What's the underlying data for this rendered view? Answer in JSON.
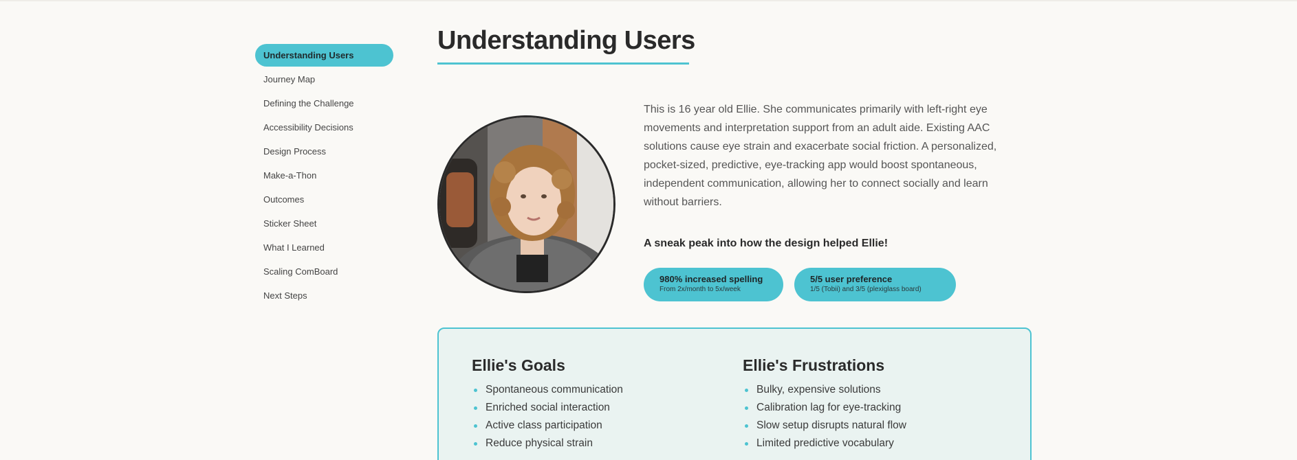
{
  "sidebar": {
    "items": [
      {
        "label": "Understanding Users",
        "active": true
      },
      {
        "label": "Journey Map"
      },
      {
        "label": "Defining the Challenge"
      },
      {
        "label": "Accessibility Decisions"
      },
      {
        "label": "Design Process"
      },
      {
        "label": "Make-a-Thon"
      },
      {
        "label": "Outcomes"
      },
      {
        "label": "Sticker Sheet"
      },
      {
        "label": "What I Learned"
      },
      {
        "label": "Scaling ComBoard"
      },
      {
        "label": "Next Steps"
      }
    ]
  },
  "main": {
    "title": "Understanding Users",
    "intro": "This is 16 year old Ellie. She communicates primarily with left-right eye movements and interpretation support from an adult aide. Existing AAC solutions cause eye strain and exacerbate social friction. A personalized, pocket-sized, predictive, eye-tracking app would boost spontaneous, independent communication, allowing her to connect socially and learn without barriers.",
    "sneak_peek": "A sneak peak into how the design helped Ellie!",
    "stats": [
      {
        "headline": "980% increased spelling",
        "detail": "From 2x/month to 5x/week"
      },
      {
        "headline": "5/5 user preference",
        "detail": "1/5 (Tobii) and 3/5 (plexiglass board)"
      }
    ]
  },
  "card": {
    "goals": {
      "title": "Ellie's Goals",
      "items": [
        "Spontaneous communication",
        "Enriched social interaction",
        "Active class participation",
        "Reduce physical strain"
      ]
    },
    "frustrations": {
      "title": "Ellie's Frustrations",
      "items": [
        "Bulky, expensive solutions",
        "Calibration lag for eye-tracking",
        "Slow setup disrupts natural flow",
        "Limited predictive vocabulary"
      ]
    }
  },
  "colors": {
    "accent": "#4dc3d1",
    "background": "#faf9f6",
    "card_bg": "#eaf3f1",
    "text": "#2b2b2b"
  }
}
